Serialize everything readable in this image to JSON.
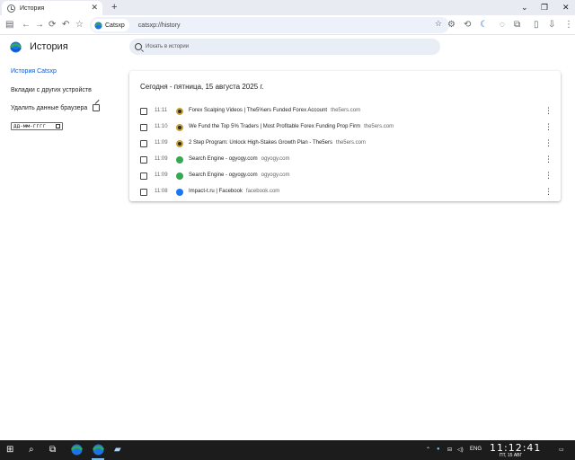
{
  "tab": {
    "title": "История",
    "close": "✕",
    "new_tab": "+"
  },
  "window_controls": {
    "collapse": "⌄",
    "minimize": "—",
    "restore": "❐",
    "close": "✕"
  },
  "toolbar": {
    "site_name": "Catsxp",
    "url": "catsxp://history"
  },
  "header": {
    "title": "История",
    "search_placeholder": "Искать в истории"
  },
  "sidebar": {
    "items": [
      {
        "label": "История Catsxp",
        "active": true
      },
      {
        "label": "Вкладки с других устройств",
        "active": false
      },
      {
        "label": "Удалить данные браузера",
        "active": false
      }
    ],
    "date_placeholder": "дд-мм-гггг"
  },
  "history": {
    "heading": "Сегодня - пятница, 15 августа 2025 г.",
    "entries": [
      {
        "time": "11:11",
        "title": "Forex Scalping Videos | The5%ers Funded Forex Account",
        "domain": "the5ers.com",
        "favicon": "the5ers-icon"
      },
      {
        "time": "11:10",
        "title": "We Fund the Top 5% Traders | Most Profitable Forex Funding Prop Firm",
        "domain": "the5ers.com",
        "favicon": "the5ers-icon"
      },
      {
        "time": "11:09",
        "title": "2 Step Program: Unlock High-Stakes Growth Plan - The5ers",
        "domain": "the5ers.com",
        "favicon": "the5ers-icon"
      },
      {
        "time": "11:09",
        "title": "Search Engine - ogyogy.com",
        "domain": "ogyogy.com",
        "favicon": "ogyogy-icon"
      },
      {
        "time": "11:09",
        "title": "Search Engine - ogyogy.com",
        "domain": "ogyogy.com",
        "favicon": "ogyogy-icon"
      },
      {
        "time": "11:08",
        "title": "Impact-t.ru | Facebook",
        "domain": "facebook.com",
        "favicon": "facebook-icon"
      }
    ],
    "menu_glyph": "⋮"
  },
  "taskbar": {
    "language": "ENG",
    "time": "11:12:41",
    "date": "ПТ, 15 АВГ"
  },
  "colors": {
    "accent": "#0b57d0",
    "the5ers": "#c8a23a",
    "ogyogy": "#34a853",
    "facebook": "#1877f2"
  }
}
